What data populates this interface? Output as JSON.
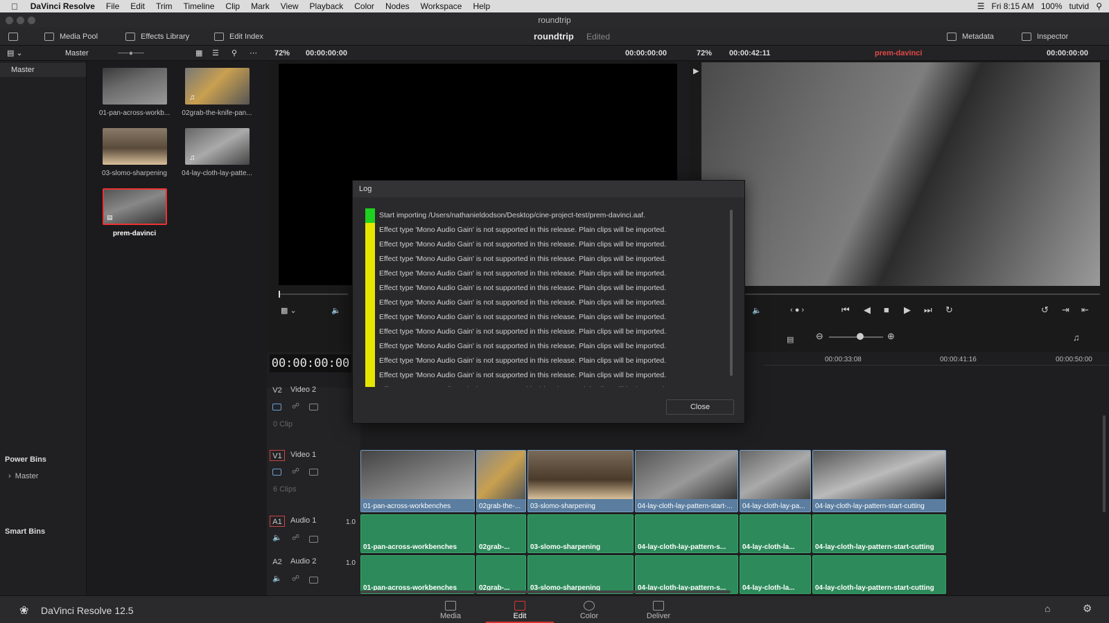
{
  "menubar": {
    "app": "DaVinci Resolve",
    "items": [
      "File",
      "Edit",
      "Trim",
      "Timeline",
      "Clip",
      "Mark",
      "View",
      "Playback",
      "Color",
      "Nodes",
      "Workspace",
      "Help"
    ],
    "time": "Fri 8:15 AM",
    "battery": "100%",
    "user": "tutvid"
  },
  "window": {
    "title": "roundtrip"
  },
  "toolbar": {
    "media_pool": "Media Pool",
    "effects_library": "Effects Library",
    "edit_index": "Edit Index",
    "project_title": "roundtrip",
    "project_status": "Edited",
    "metadata": "Metadata",
    "inspector": "Inspector"
  },
  "subbar": {
    "bin": "Master",
    "src_zoom": "72%",
    "src_tc": "00:00:00:00",
    "src_tc2": "00:00:00:00",
    "prog_zoom": "72%",
    "prog_duration": "00:00:42:11",
    "timeline_name": "prem-davinci",
    "prog_tc": "00:00:00:00"
  },
  "sidebar": {
    "master": "Master",
    "power_bins": "Power Bins",
    "power_master": "Master",
    "smart_bins": "Smart Bins"
  },
  "clips": [
    {
      "name": "01-pan-across-workb..."
    },
    {
      "name": "02grab-the-knife-pan..."
    },
    {
      "name": "03-slomo-sharpening"
    },
    {
      "name": "04-lay-cloth-lay-patte..."
    },
    {
      "name": "prem-davinci"
    }
  ],
  "timeline": {
    "timecode": "00:00:00:00",
    "ruler": [
      "00:00:33:08",
      "00:00:41:16",
      "00:00:50:00"
    ],
    "v2": {
      "id": "V2",
      "name": "Video 2",
      "count": "0 Clip"
    },
    "v1": {
      "id": "V1",
      "name": "Video 1",
      "count": "6 Clips"
    },
    "a1": {
      "id": "A1",
      "name": "Audio 1",
      "level": "1.0"
    },
    "a2": {
      "id": "A2",
      "name": "Audio 2",
      "level": "1.0"
    },
    "video_clips": [
      "01-pan-across-workbenches",
      "02grab-the-...",
      "03-slomo-sharpening",
      "04-lay-cloth-lay-pattern-start-...",
      "04-lay-cloth-lay-pa...",
      "04-lay-cloth-lay-pattern-start-cutting"
    ],
    "audio1_clips": [
      "01-pan-across-workbenches",
      "02grab-...",
      "03-slomo-sharpening",
      "04-lay-cloth-lay-pattern-s...",
      "04-lay-cloth-la...",
      "04-lay-cloth-lay-pattern-start-cutting"
    ],
    "audio2_clips": [
      "01-pan-across-workbenches",
      "02grab-...",
      "03-slomo-sharpening",
      "04-lay-cloth-lay-pattern-s...",
      "04-lay-cloth-la...",
      "04-lay-cloth-lay-pattern-start-cutting"
    ]
  },
  "log": {
    "title": "Log",
    "close": "Close",
    "colors": {
      "ok": "#1fd11f",
      "warn": "#e6e600"
    },
    "entries": [
      {
        "level": "ok",
        "text": "Start importing /Users/nathanieldodson/Desktop/cine-project-test/prem-davinci.aaf."
      },
      {
        "level": "warn",
        "text": "Effect type 'Mono Audio Gain' is not supported in this release. Plain clips will be imported."
      },
      {
        "level": "warn",
        "text": "Effect type 'Mono Audio Gain' is not supported in this release. Plain clips will be imported."
      },
      {
        "level": "warn",
        "text": "Effect type 'Mono Audio Gain' is not supported in this release. Plain clips will be imported."
      },
      {
        "level": "warn",
        "text": "Effect type 'Mono Audio Gain' is not supported in this release. Plain clips will be imported."
      },
      {
        "level": "warn",
        "text": "Effect type 'Mono Audio Gain' is not supported in this release. Plain clips will be imported."
      },
      {
        "level": "warn",
        "text": "Effect type 'Mono Audio Gain' is not supported in this release. Plain clips will be imported."
      },
      {
        "level": "warn",
        "text": "Effect type 'Mono Audio Gain' is not supported in this release. Plain clips will be imported."
      },
      {
        "level": "warn",
        "text": "Effect type 'Mono Audio Gain' is not supported in this release. Plain clips will be imported."
      },
      {
        "level": "warn",
        "text": "Effect type 'Mono Audio Gain' is not supported in this release. Plain clips will be imported."
      },
      {
        "level": "warn",
        "text": "Effect type 'Mono Audio Gain' is not supported in this release. Plain clips will be imported."
      },
      {
        "level": "warn",
        "text": "Effect type 'Mono Audio Gain' is not supported in this release. Plain clips will be imported."
      },
      {
        "level": "warn",
        "text": "Effect type 'Mono Audio Gain' is not supported in this release. Plain clips will be imported."
      }
    ]
  },
  "pages": [
    "Media",
    "Edit",
    "Color",
    "Deliver"
  ],
  "footer": {
    "app_version": "DaVinci Resolve 12.5"
  }
}
